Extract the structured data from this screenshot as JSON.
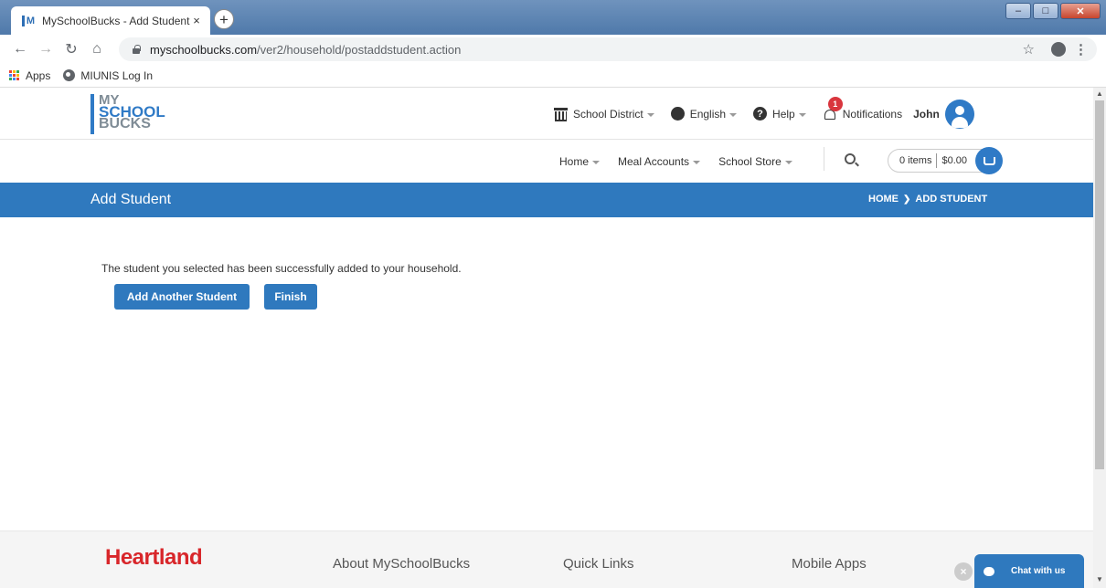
{
  "browser": {
    "tab_title": "MySchoolBucks - Add Student",
    "tab_close": "×",
    "new_tab": "+",
    "url_host": "myschoolbucks.com",
    "url_path": "/ver2/household/postaddstudent.action",
    "bookmarks": [
      {
        "label": "Apps",
        "icon": "apps-icon"
      },
      {
        "label": "MIUNIS Log In",
        "icon": "globe-icon"
      }
    ],
    "apps_colors": [
      "#ea4335",
      "#fbbc05",
      "#34a853",
      "#4285f4",
      "#ea4335",
      "#fbbc05",
      "#34a853",
      "#4285f4",
      "#ea4335"
    ]
  },
  "logo": {
    "line1": "MY",
    "line2": "SCHOOL",
    "line3": "BUCKS"
  },
  "topnav": {
    "district": "School District",
    "language": "English",
    "help": "Help",
    "notifications": "Notifications",
    "notification_count": "1",
    "user": "John"
  },
  "subnav": {
    "home": "Home",
    "meal_accounts": "Meal Accounts",
    "school_store": "School Store",
    "cart_items": "0 items",
    "cart_total": "$0.00"
  },
  "band": {
    "title": "Add Student",
    "crumb_home": "HOME",
    "crumb_sep": "❯",
    "crumb_current": "ADD STUDENT"
  },
  "content": {
    "message": "The student you selected has been successfully added to your household.",
    "add_another": "Add Another Student",
    "finish": "Finish"
  },
  "footer": {
    "brand": "Heartland",
    "col1": "About MySchoolBucks",
    "col2": "Quick Links",
    "col3": "Mobile Apps",
    "chat": "Chat with us",
    "chat_close": "×"
  },
  "colors": {
    "primary": "#2f79be",
    "brand_red": "#d8262a",
    "badge": "#d9363e"
  }
}
